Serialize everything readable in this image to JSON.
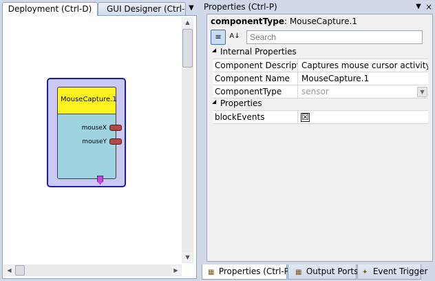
{
  "left_tabs": {
    "deployment": "Deployment (Ctrl-D)",
    "gui_designer": "GUI Designer (Ctrl-G)"
  },
  "component": {
    "title": "MouseCapture.1",
    "ports": [
      "mouseX",
      "mouseY"
    ]
  },
  "properties": {
    "header": "Properties (Ctrl-P)",
    "type_label": "componentType",
    "type_value": ": MouseCapture.1",
    "search_placeholder": "Search",
    "categories": {
      "internal": "Internal Properties",
      "properties": "Properties"
    },
    "internal_rows": [
      {
        "name": "Component Descriptic",
        "value": "Captures mouse cursor activity fror"
      },
      {
        "name": "Component Name",
        "value": "MouseCapture.1"
      },
      {
        "name": "ComponentType",
        "value": "sensor"
      }
    ],
    "property_rows": [
      {
        "name": "blockEvents",
        "value": "☒"
      }
    ]
  },
  "bottom_tabs": {
    "properties": "Properties (Ctrl-P)",
    "output_ports": "Output Ports",
    "event_trigger": "Event Trigger"
  },
  "colors": {
    "component_title": "#fff31f",
    "component_body": "#9fd3df",
    "component_outer": "#c9c9f4",
    "port": "#b04a4a",
    "event_port": "#c54ad8"
  },
  "icons": {
    "pin": "pin-icon",
    "close": "close-icon",
    "categorized": "categorized-icon",
    "alphabetical": "sort-alpha-icon"
  }
}
